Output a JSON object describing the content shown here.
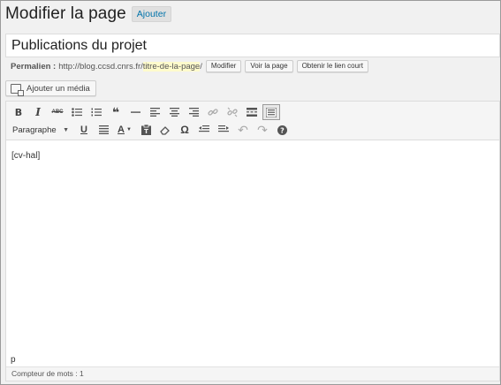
{
  "header": {
    "title": "Modifier la page",
    "add_new_label": "Ajouter"
  },
  "post": {
    "title": "Publications du projet"
  },
  "permalink": {
    "label": "Permalien :",
    "base_url": "http://blog.ccsd.cnrs.fr/",
    "slug": "titre-de-la-page",
    "trailing": "/",
    "edit_label": "Modifier",
    "view_label": "Voir la page",
    "shortlink_label": "Obtenir le lien court"
  },
  "media": {
    "add_label": "Ajouter un média"
  },
  "toolbar": {
    "row1": [
      {
        "name": "bold",
        "glyph": "B"
      },
      {
        "name": "italic",
        "glyph": "I"
      },
      {
        "name": "strikethrough",
        "glyph": "ABC"
      },
      {
        "name": "bullet-list",
        "glyph": "bullets"
      },
      {
        "name": "numbered-list",
        "glyph": "numbers"
      },
      {
        "name": "blockquote",
        "glyph": "❝"
      },
      {
        "name": "horizontal-line",
        "glyph": "—"
      },
      {
        "name": "align-left",
        "glyph": "align-left"
      },
      {
        "name": "align-center",
        "glyph": "align-center"
      },
      {
        "name": "align-right",
        "glyph": "align-right"
      },
      {
        "name": "insert-link",
        "glyph": "link"
      },
      {
        "name": "remove-link",
        "glyph": "unlink"
      },
      {
        "name": "read-more",
        "glyph": "more"
      },
      {
        "name": "toolbar-toggle",
        "glyph": "kitchen"
      }
    ],
    "format_select": "Paragraphe",
    "row2": [
      {
        "name": "underline",
        "glyph": "U"
      },
      {
        "name": "justify",
        "glyph": "justify"
      },
      {
        "name": "text-color",
        "glyph": "A"
      },
      {
        "name": "paste-as-text",
        "glyph": "paste"
      },
      {
        "name": "clear-formatting",
        "glyph": "eraser"
      },
      {
        "name": "special-character",
        "glyph": "Ω"
      },
      {
        "name": "outdent",
        "glyph": "outdent"
      },
      {
        "name": "indent",
        "glyph": "indent"
      },
      {
        "name": "undo",
        "glyph": "↶"
      },
      {
        "name": "redo",
        "glyph": "↷"
      },
      {
        "name": "help",
        "glyph": "?"
      }
    ]
  },
  "editor": {
    "content": "[cv-hal]",
    "path": "p",
    "word_count": "Compteur de mots : 1"
  }
}
